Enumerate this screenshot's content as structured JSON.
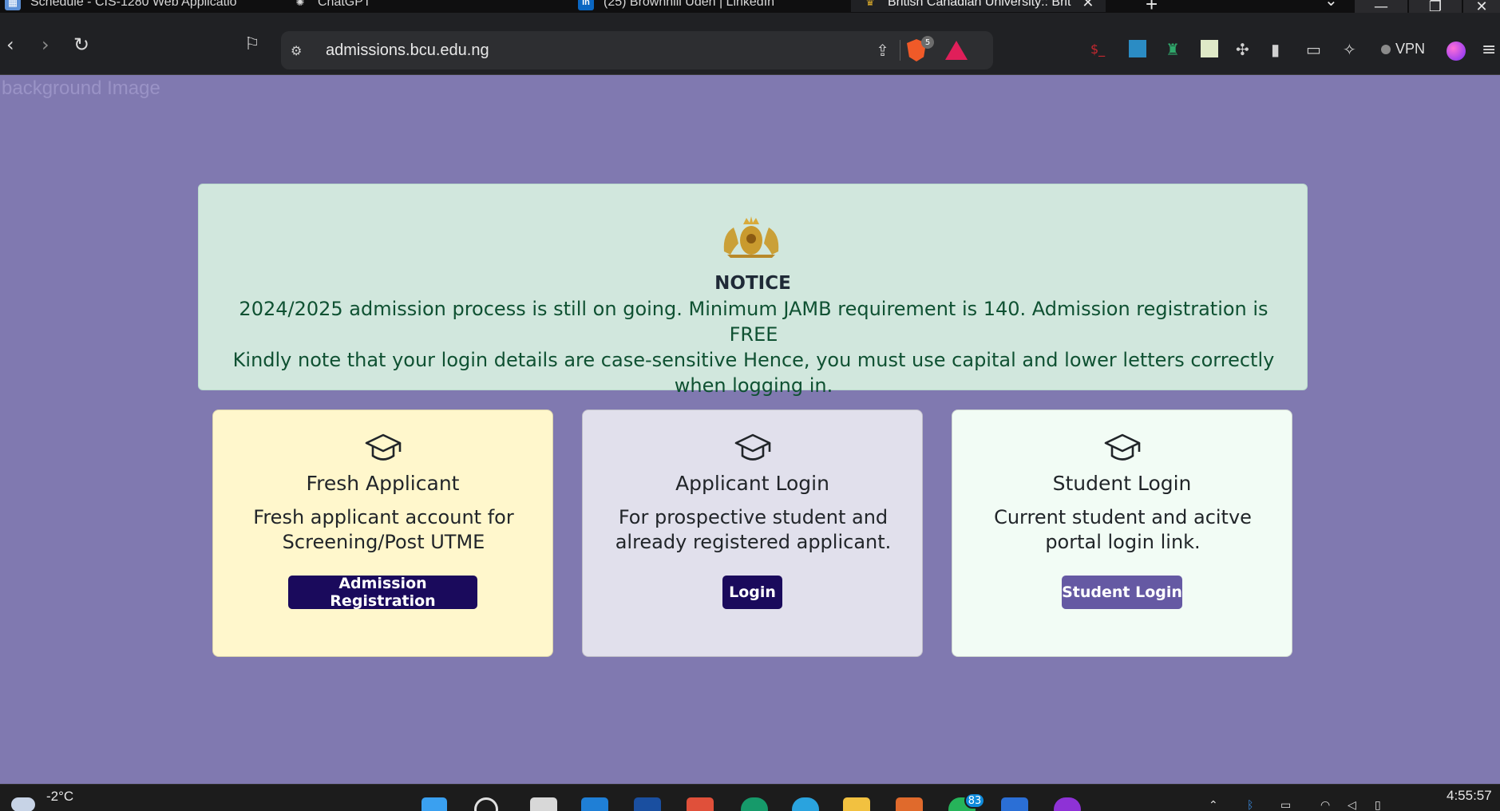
{
  "browser": {
    "tabs": [
      {
        "title": "Schedule - CIS-1280 Web Applicatio",
        "icon": "schedule-icon"
      },
      {
        "title": "ChatGPT",
        "icon": "chatgpt-icon"
      },
      {
        "title": "(25) Brownhill Udeh | LinkedIn",
        "icon": "linkedin-icon"
      },
      {
        "title": "British Canadian University:: Brit",
        "icon": "crest-icon",
        "active": true
      }
    ],
    "new_tab": "+",
    "url": "admissions.bcu.edu.ng",
    "brave_shield_count": "5",
    "vpn_label": "VPN"
  },
  "page": {
    "background_alt": "background Image",
    "notice": {
      "title": "NOTICE",
      "line1": "2024/2025 admission process is still on going. Minimum JAMB requirement is 140. Admission registration is FREE",
      "line2": "Kindly note that your login details are case-sensitive Hence, you must use capital and lower letters correctly when logging in."
    },
    "cards": [
      {
        "title": "Fresh Applicant",
        "description": "Fresh applicant account for Screening/Post UTME",
        "button": "Admission Registration"
      },
      {
        "title": "Applicant Login",
        "description": "For prospective student and already registered applicant.",
        "button": "Login"
      },
      {
        "title": "Student Login",
        "description": "Current student and acitve portal login link.",
        "button": "Student Login"
      }
    ]
  },
  "taskbar": {
    "weather": "-2°C",
    "chat_badge": "83",
    "time": "4:55:57"
  },
  "colors": {
    "page_background": "#8079b0",
    "notice_background": "#d1e7dd",
    "fresh_card": "#fff7cc",
    "applicant_card": "#e1e0ec",
    "student_card": "#f2fcf5",
    "primary_button": "#1a0a5c",
    "student_button": "#6559a3"
  }
}
